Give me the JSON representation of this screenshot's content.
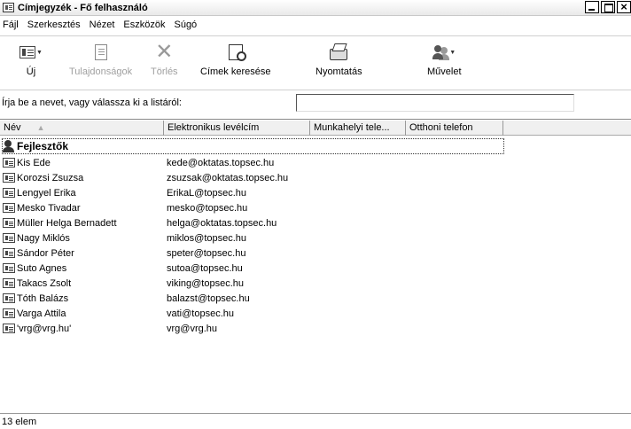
{
  "window": {
    "title": "Címjegyzék - Fő felhasználó"
  },
  "menu": [
    "Fájl",
    "Szerkesztés",
    "Nézet",
    "Eszközök",
    "Súgó"
  ],
  "toolbar": {
    "new": "Új",
    "properties": "Tulajdonságok",
    "delete": "Törlés",
    "find": "Címek keresése",
    "print": "Nyomtatás",
    "action": "Művelet"
  },
  "search": {
    "label": "Írja be a nevet, vagy válassza ki a listáról:",
    "value": ""
  },
  "columns": [
    "Név",
    "Elektronikus levélcím",
    "Munkahelyi tele...",
    "Otthoni telefon"
  ],
  "group": {
    "name": "Fejlesztők"
  },
  "contacts": [
    {
      "name": "Kis Ede",
      "email": "kede@oktatas.topsec.hu"
    },
    {
      "name": "Korozsi Zsuzsa",
      "email": "zsuzsak@oktatas.topsec.hu"
    },
    {
      "name": "Lengyel Erika",
      "email": "ErikaL@topsec.hu"
    },
    {
      "name": "Mesko Tivadar",
      "email": "mesko@topsec.hu"
    },
    {
      "name": "Müller Helga Bernadett",
      "email": "helga@oktatas.topsec.hu"
    },
    {
      "name": "Nagy Miklós",
      "email": "miklos@topsec.hu"
    },
    {
      "name": "Sándor Péter",
      "email": "speter@topsec.hu"
    },
    {
      "name": "Suto Agnes",
      "email": "sutoa@topsec.hu"
    },
    {
      "name": "Takacs Zsolt",
      "email": "viking@topsec.hu"
    },
    {
      "name": "Tóth Balázs",
      "email": "balazst@topsec.hu"
    },
    {
      "name": "Varga Attila",
      "email": "vati@topsec.hu"
    },
    {
      "name": "'vrg@vrg.hu'",
      "email": "vrg@vrg.hu"
    }
  ],
  "status": {
    "text": "13 elem"
  }
}
